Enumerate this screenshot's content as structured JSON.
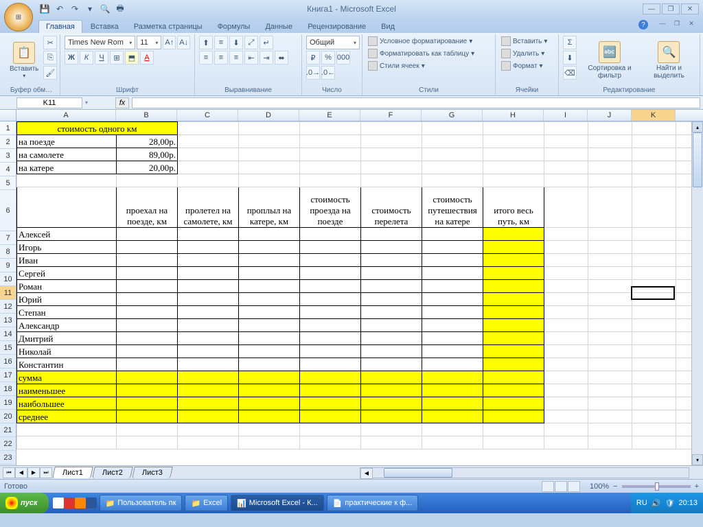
{
  "title": "Книга1 - Microsoft Excel",
  "tabs": {
    "home": "Главная",
    "insert": "Вставка",
    "layout": "Разметка страницы",
    "formulas": "Формулы",
    "data": "Данные",
    "review": "Рецензирование",
    "view": "Вид"
  },
  "groups": {
    "clipboard": "Буфер обм…",
    "font": "Шрифт",
    "align": "Выравнивание",
    "number": "Число",
    "styles": "Стили",
    "cells": "Ячейки",
    "editing": "Редактирование"
  },
  "font": {
    "name": "Times New Rom",
    "size": "11"
  },
  "number_format": "Общий",
  "paste": "Вставить",
  "styles": {
    "cond": "Условное форматирование",
    "table": "Форматировать как таблицу",
    "cell": "Стили ячеек"
  },
  "cells_cmds": {
    "insert": "Вставить",
    "delete": "Удалить",
    "format": "Формат"
  },
  "editing": {
    "sort": "Сортировка и фильтр",
    "find": "Найти и выделить"
  },
  "name_box": "K11",
  "columns": [
    "A",
    "B",
    "C",
    "D",
    "E",
    "F",
    "G",
    "H",
    "I",
    "J",
    "K"
  ],
  "sheet": {
    "title_header": "стоимость одного км",
    "r2a": "на поезде",
    "r2b": "28,00р.",
    "r3a": "на самолете",
    "r3b": "89,00р.",
    "r4a": "на катере",
    "r4b": "20,00р.",
    "h_b": "проехал на поезде, км",
    "h_c": "пролетел на самолете, км",
    "h_d": "проплыл на катере, км",
    "h_e": "стоимость проезда на поезде",
    "h_f": "стоимость перелета",
    "h_g": "стоимость путешествия на катере",
    "h_h": "итого весь путь, км",
    "n7": "Алексей",
    "n8": "Игорь",
    "n9": "Иван",
    "n10": "Сергей",
    "n11": "Роман",
    "n12": "Юрий",
    "n13": "Степан",
    "n14": "Александр",
    "n15": "Дмитрий",
    "n16": "Николай",
    "n17": "Константин",
    "n18": "сумма",
    "n19": "наименьшее",
    "n20": "наибольшее",
    "n21": "среднее"
  },
  "sheet_tabs": {
    "s1": "Лист1",
    "s2": "Лист2",
    "s3": "Лист3"
  },
  "status": "Готово",
  "zoom": "100%",
  "taskbar": {
    "start": "пуск",
    "t1": "Пользователь пк",
    "t2": "Excel",
    "t3": "Microsoft Excel - К...",
    "t4": "практические к ф...",
    "lang": "RU",
    "time": "20:13"
  }
}
